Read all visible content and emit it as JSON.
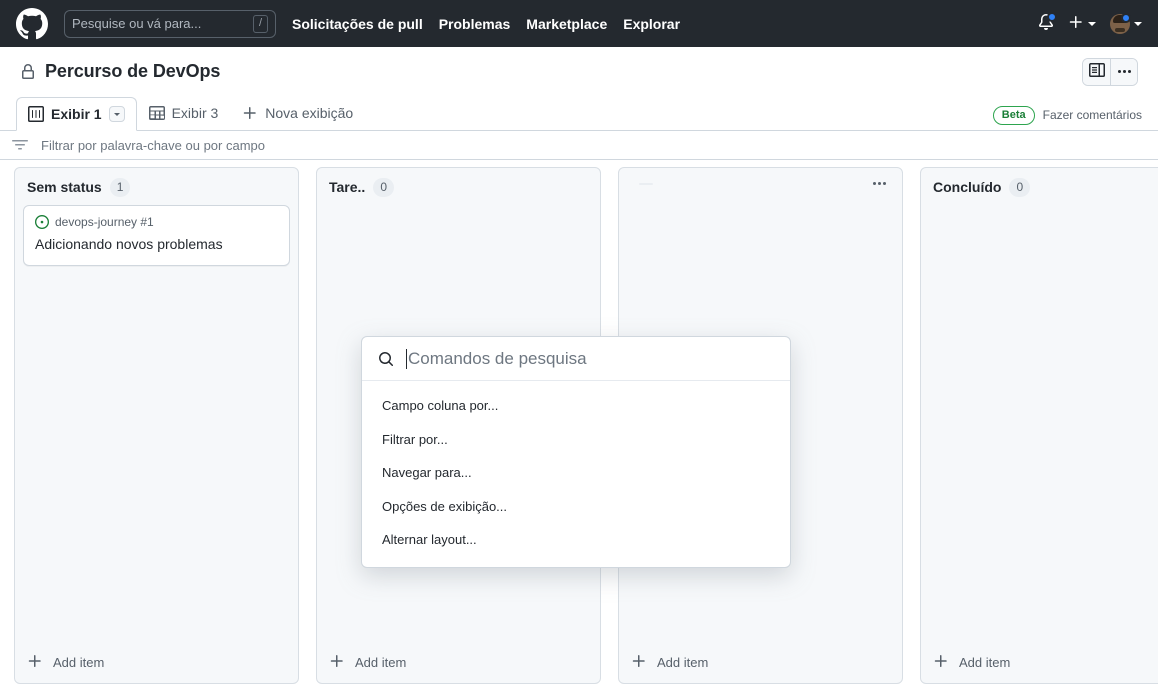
{
  "topnav": {
    "logo_icon": "github-mark-icon",
    "search": {
      "placeholder": "Pesquise ou vá para...",
      "shortcut": "/"
    },
    "links": [
      {
        "label": "Solicitações de pull"
      },
      {
        "label": "Problemas"
      },
      {
        "label": "Marketplace"
      },
      {
        "label": "Explorar"
      }
    ],
    "notifications_icon": "bell-icon",
    "create_icon": "plus-icon",
    "avatar_icon": "avatar"
  },
  "project": {
    "visibility_icon": "lock-icon",
    "title": "Percurso de DevOps",
    "sidebar_toggle_icon": "side-panel-icon",
    "more_menu_icon": "kebab-horizontal-icon"
  },
  "tabs": {
    "items": [
      {
        "label": "Exibir 1",
        "icon": "project-board-icon",
        "active": true,
        "has_caret": true
      },
      {
        "label": "Exibir 3",
        "icon": "table-icon",
        "active": false,
        "has_caret": false
      }
    ],
    "new_view_label": "Nova exibição",
    "new_view_icon": "plus-icon",
    "beta_badge": "Beta",
    "feedback_label": "Fazer comentários"
  },
  "filter": {
    "icon": "filter-icon",
    "placeholder": "Filtrar por palavra-chave ou por campo",
    "value": ""
  },
  "board": {
    "add_item_label": "Add item",
    "add_item_icon": "plus-icon",
    "columns": [
      {
        "title": "Sem status",
        "count": "1",
        "cards": [
          {
            "repo": "devops-journey #1",
            "title": "Adicionando novos problemas",
            "status_icon": "issue-opened-icon"
          }
        ]
      },
      {
        "title": "Tare..",
        "count": "0",
        "cards": []
      },
      {
        "title": "",
        "count": "",
        "cards": []
      },
      {
        "title": "Concluído",
        "count": "0",
        "cards": []
      }
    ]
  },
  "command_palette": {
    "search_icon": "search-icon",
    "placeholder": "Comandos de pesquisa",
    "value": "",
    "items": [
      {
        "label": "Campo coluna por..."
      },
      {
        "label": "Filtrar por..."
      },
      {
        "label": "Navegar para..."
      },
      {
        "label": "Opções de exibição..."
      },
      {
        "label": "Alternar layout..."
      }
    ]
  },
  "colors": {
    "nav_bg": "#24292f",
    "accent_blue": "#2f81f7",
    "beta_green": "#2da44e",
    "issue_green": "#1a7f37",
    "column_bg": "#f6f8fa",
    "border": "#d0d7de"
  }
}
